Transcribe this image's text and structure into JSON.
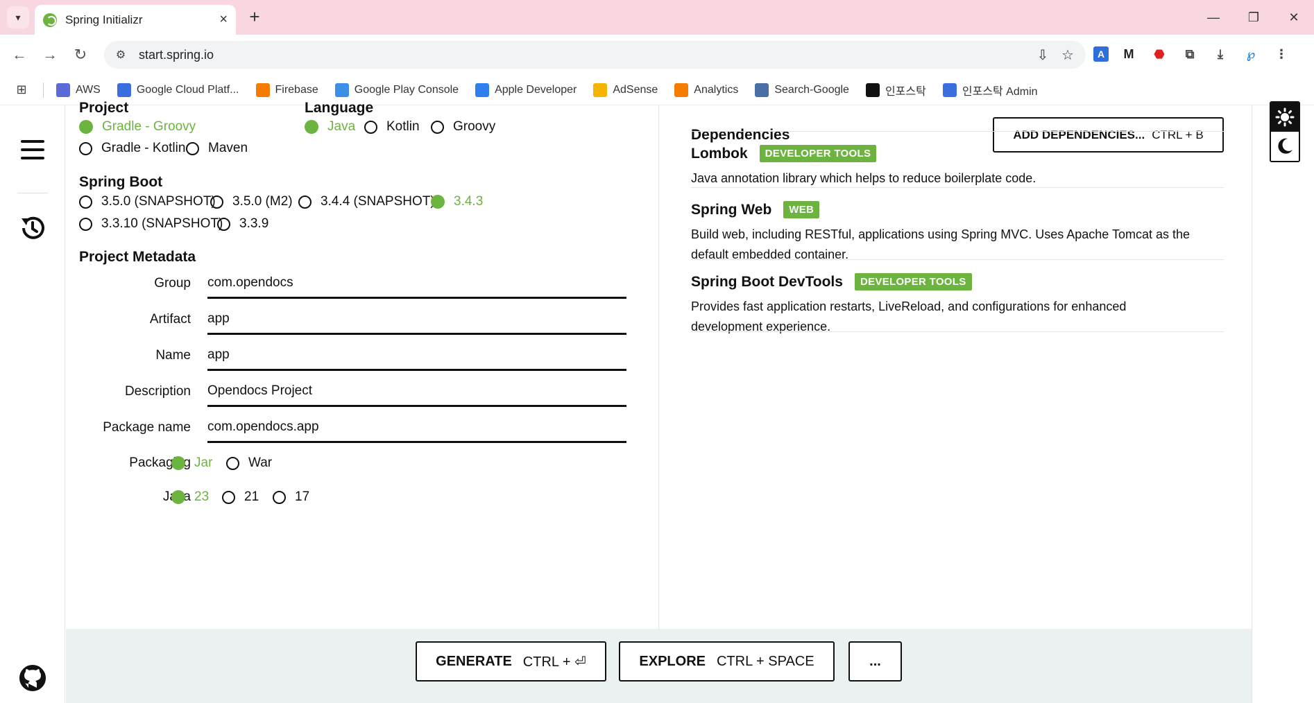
{
  "browser": {
    "tab_title": "Spring Initializr",
    "url": "start.spring.io",
    "bookmarks": [
      {
        "label": "AWS",
        "icon": "aws-icon",
        "color": "#5a6bd8"
      },
      {
        "label": "Google Cloud Platf...",
        "icon": "api-icon",
        "color": "#3b6fe0"
      },
      {
        "label": "Firebase",
        "icon": "firebase-icon",
        "color": "#f57c00"
      },
      {
        "label": "Google Play Console",
        "icon": "play-console-icon",
        "color": "#3c8ee6"
      },
      {
        "label": "Apple Developer",
        "icon": "apple-developer-icon",
        "color": "#2f80ed"
      },
      {
        "label": "AdSense",
        "icon": "adsense-icon",
        "color": "#f4b400"
      },
      {
        "label": "Analytics",
        "icon": "analytics-icon",
        "color": "#f57c00"
      },
      {
        "label": "Search-Google",
        "icon": "search-google-icon",
        "color": "#4a6fa5"
      },
      {
        "label": "인포스탁",
        "icon": "infostock-icon",
        "color": "#111111"
      },
      {
        "label": "인포스탁 Admin",
        "icon": "infostock-admin-icon",
        "color": "#3b6fe0"
      }
    ]
  },
  "project": {
    "title": "Project",
    "options": [
      "Gradle - Groovy",
      "Gradle - Kotlin",
      "Maven"
    ],
    "selected": "Gradle - Groovy"
  },
  "language": {
    "title": "Language",
    "options": [
      "Java",
      "Kotlin",
      "Groovy"
    ],
    "selected": "Java"
  },
  "spring_boot": {
    "title": "Spring Boot",
    "options": [
      "3.5.0 (SNAPSHOT)",
      "3.5.0 (M2)",
      "3.4.4 (SNAPSHOT)",
      "3.4.3",
      "3.3.10 (SNAPSHOT)",
      "3.3.9"
    ],
    "selected": "3.4.3"
  },
  "metadata": {
    "title": "Project Metadata",
    "fields": [
      {
        "label": "Group",
        "value": "com.opendocs"
      },
      {
        "label": "Artifact",
        "value": "app"
      },
      {
        "label": "Name",
        "value": "app"
      },
      {
        "label": "Description",
        "value": "Opendocs Project"
      },
      {
        "label": "Package name",
        "value": "com.opendocs.app"
      }
    ],
    "packaging": {
      "label": "Packaging",
      "options": [
        "Jar",
        "War"
      ],
      "selected": "Jar"
    },
    "java": {
      "label": "Java",
      "options": [
        "23",
        "21",
        "17"
      ],
      "selected": "23"
    }
  },
  "dependencies": {
    "title": "Dependencies",
    "add_button": {
      "label": "ADD DEPENDENCIES...",
      "shortcut": "CTRL + B"
    },
    "items": [
      {
        "name": "Lombok",
        "badge": "DEVELOPER TOOLS",
        "description": "Java annotation library which helps to reduce boilerplate code."
      },
      {
        "name": "Spring Web",
        "badge": "WEB",
        "description": "Build web, including RESTful, applications using Spring MVC. Uses Apache Tomcat as the default embedded container."
      },
      {
        "name": "Spring Boot DevTools",
        "badge": "DEVELOPER TOOLS",
        "description": "Provides fast application restarts, LiveReload, and configurations for enhanced development experience."
      }
    ]
  },
  "footer": {
    "generate": {
      "label": "GENERATE",
      "shortcut": "CTRL + ⏎"
    },
    "explore": {
      "label": "EXPLORE",
      "shortcut": "CTRL + SPACE"
    },
    "more": {
      "label": "..."
    }
  },
  "colors": {
    "accent": "#6db33f",
    "footer_bg": "#ebf1f1",
    "tabbar_bg": "#f9d7e0"
  }
}
